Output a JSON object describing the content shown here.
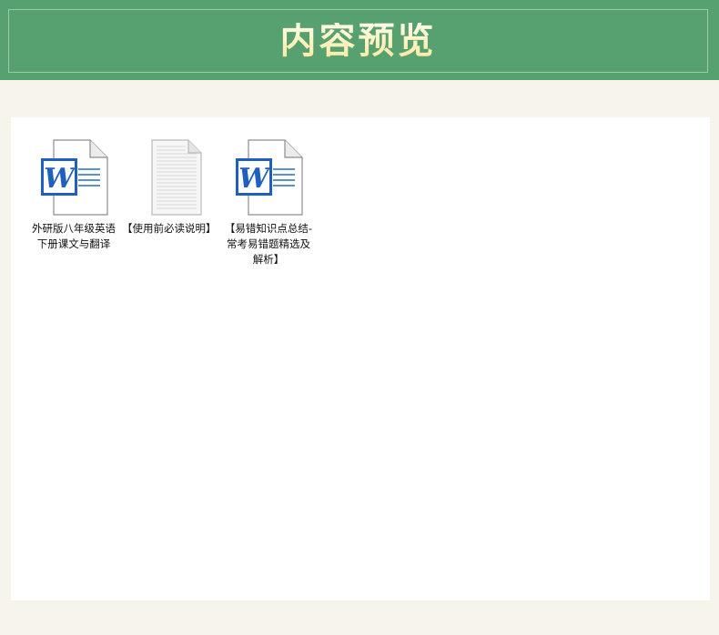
{
  "header": {
    "title": "内容预览"
  },
  "files": [
    {
      "name": "外研版八年级英语下册课文与翻译",
      "icon": "word-doc-icon"
    },
    {
      "name": "【使用前必读说明】",
      "icon": "text-doc-icon"
    },
    {
      "name": "【易错知识点总结-常考易错题精选及解析】",
      "icon": "word-doc-icon"
    }
  ],
  "colors": {
    "header_bg": "#57a06f",
    "title": "#fff6cc",
    "page_bg": "#f7f4ec",
    "panel_bg": "#ffffff",
    "word_blue": "#1f5fbf"
  }
}
